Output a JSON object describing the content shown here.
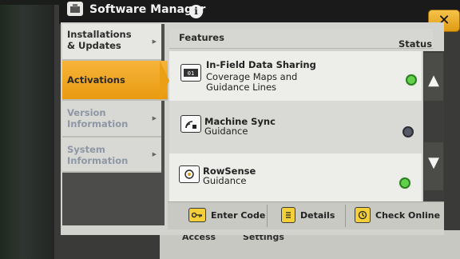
{
  "window": {
    "title": "Software Manager"
  },
  "nav": {
    "items": [
      {
        "label": "Installations & Updates",
        "state": "normal"
      },
      {
        "label": "Activations",
        "state": "active"
      },
      {
        "label": "Version Information",
        "state": "dim"
      },
      {
        "label": "System Information",
        "state": "dim"
      }
    ]
  },
  "table": {
    "header_features": "Features",
    "header_status": "Status",
    "rows": [
      {
        "name": "In-Field Data Sharing",
        "desc": "Coverage Maps and Guidance Lines",
        "status": "on",
        "icon": "data-sharing-icon"
      },
      {
        "name": "Machine Sync",
        "desc": "Guidance",
        "status": "off",
        "icon": "machine-sync-icon"
      },
      {
        "name": "RowSense",
        "desc": "Guidance",
        "status": "on",
        "icon": "rowsense-icon"
      }
    ]
  },
  "footer": {
    "enter_code": "Enter Code",
    "details": "Details",
    "check_online": "Check Online"
  },
  "behind": {
    "left": "Access",
    "right": "Settings"
  },
  "colors": {
    "accent": "#e99a10",
    "status_on": "#5fd24a",
    "status_off": "#555a66"
  }
}
